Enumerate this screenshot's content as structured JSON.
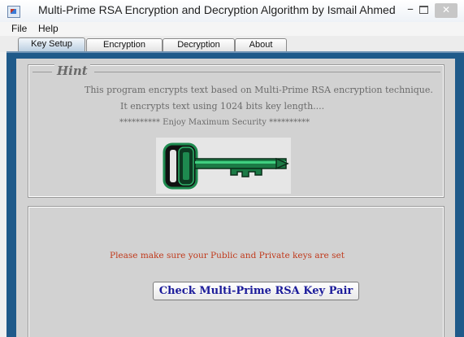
{
  "window": {
    "title": "Multi-Prime RSA Encryption and Decryption Algorithm by Ismail Ahmed",
    "minimize": "–",
    "close": "✕"
  },
  "menu": {
    "items": [
      "File",
      "Help"
    ]
  },
  "tabs": [
    {
      "label": "Key Setup",
      "active": true
    },
    {
      "label": "Encryption",
      "active": false
    },
    {
      "label": "Decryption",
      "active": false
    },
    {
      "label": "About",
      "active": false
    }
  ],
  "hint": {
    "title": "Hint",
    "lines": [
      "This program encrypts text based on Multi-Prime RSA encryption technique.",
      "It encrypts text using 1024 bits key length....",
      "********** Enjoy Maximum Security **********"
    ],
    "image": "green-key-icon"
  },
  "key_setup": {
    "warning": "Please make sure your Public and Private keys are set",
    "check_button": "Check Multi-Prime RSA Key Pair"
  },
  "colors": {
    "frame": "#1f5a8a",
    "panel": "#d2d2d2",
    "warning": "#c0391b",
    "button_text": "#1b1b9a",
    "key": "#1e8a4f"
  }
}
